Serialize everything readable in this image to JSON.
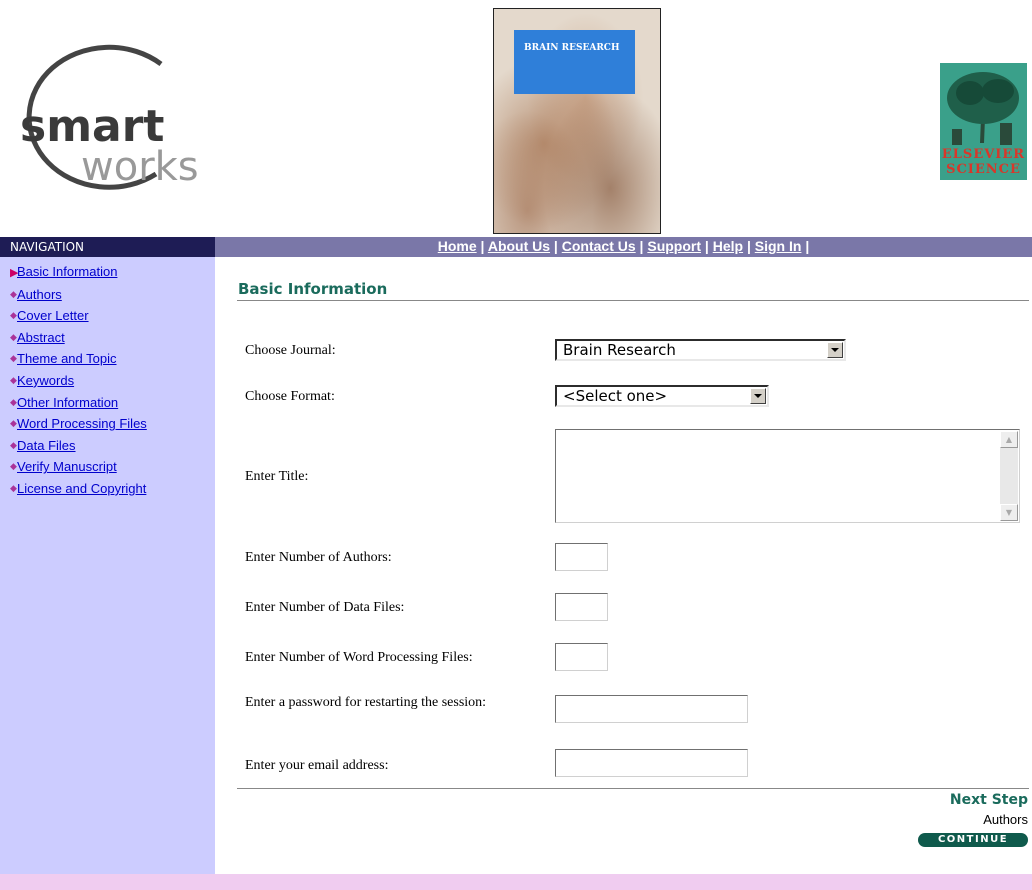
{
  "header": {
    "logo_word1": "smart",
    "logo_word2": "works",
    "cover_title": "BRAIN RESEARCH",
    "publisher_line1": "ELSEVIER",
    "publisher_line2": "SCIENCE"
  },
  "nav": {
    "label": "NAVIGATION",
    "top_links": [
      "Home",
      "About Us",
      "Contact Us",
      "Support",
      "Help",
      "Sign In"
    ],
    "sidebar_items": [
      "Basic Information",
      "Authors",
      "Cover Letter",
      "Abstract",
      "Theme and Topic",
      "Keywords",
      "Other Information",
      "Word Processing Files",
      "Data Files",
      "Verify Manuscript",
      "License and Copyright"
    ],
    "current_index": 0
  },
  "main": {
    "title": "Basic Information",
    "fields": {
      "journal_label": "Choose Journal:",
      "journal_value": "Brain Research",
      "format_label": "Choose Format:",
      "format_value": "<Select one>",
      "title_label": "Enter Title:",
      "title_value": "",
      "num_authors_label": "Enter Number of Authors:",
      "num_data_files_label": "Enter Number of Data Files:",
      "num_wp_files_label": "Enter Number of Word Processing Files:",
      "password_label": "Enter a password for restarting the session:",
      "email_label": "Enter your email address:"
    },
    "next_step_label": "Next Step",
    "next_step_target": "Authors",
    "continue_label": "CONTINUE"
  },
  "colors": {
    "nav_bar": "#7a77a8",
    "nav_label_bg": "#1e1c55",
    "sidebar_bg": "#ccccff",
    "heading_green": "#1a6b5c",
    "footer_bg": "#f0ccf0"
  }
}
